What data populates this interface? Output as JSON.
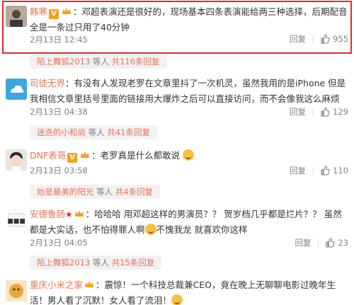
{
  "comments": [
    {
      "user": "韩寒",
      "text": "：邓超表演还是很好的，现场基本四条表演能给两三种选择，后期配音全是一条过只用了40分钟",
      "date": "2月13日 12:45",
      "reply_label": "回复",
      "likes": "955",
      "badges": [
        "v",
        "crown"
      ]
    },
    {
      "reply_bar": {
        "who": "陌上舞狐2013",
        "mid": " 等人 ",
        "count": "共116条回复"
      }
    },
    {
      "user": "司徒无界",
      "text": "：有没有人发现老罗在文章里抖了一次机灵，虽然我用的是iPhone 但是我相信文章里括号里面的链接用大爆炸之后可以直接访问，而不会像我这么麻烦",
      "date": "2月13日 04:38",
      "reply_label": "回复",
      "likes": "129",
      "badges": []
    },
    {
      "reply_bar": {
        "who": "迷迭的小和尚",
        "mid": " 等人 ",
        "count": "共41条回复"
      }
    },
    {
      "user": "DNF表哥",
      "text": "：老罗真是什么都敢说",
      "date": "2月13日 03:58",
      "reply_label": "回复",
      "likes": "110",
      "badges": [
        "v",
        "crown"
      ]
    },
    {
      "reply_bar": {
        "who": "始是最美的阳光",
        "mid": " 等人 ",
        "count": "共4条回复"
      }
    },
    {
      "user": "安德鲁肠",
      "text": "：哈哈哈 用邓超这样的男演员？？ 贺岁档几乎都是烂片？？ 虽然都是大实话，也不怕得罪人啊",
      "text2": "不愧我龙 就喜欢你这样",
      "date": "2月13日 04:05",
      "reply_label": "回复",
      "likes": "23",
      "badges": [
        "star",
        "crown"
      ]
    },
    {
      "reply_bar": {
        "who": "陌上舞狐2013",
        "mid": " 等人 ",
        "count": "共15条回复"
      }
    },
    {
      "user": "重庆小米之家",
      "text": "：震惊！一个科技总裁兼CEO，竟在晚上无聊聊电影过晚年生活！男人看了沉默！女人看了流泪！",
      "badges": [
        "crown"
      ]
    }
  ]
}
